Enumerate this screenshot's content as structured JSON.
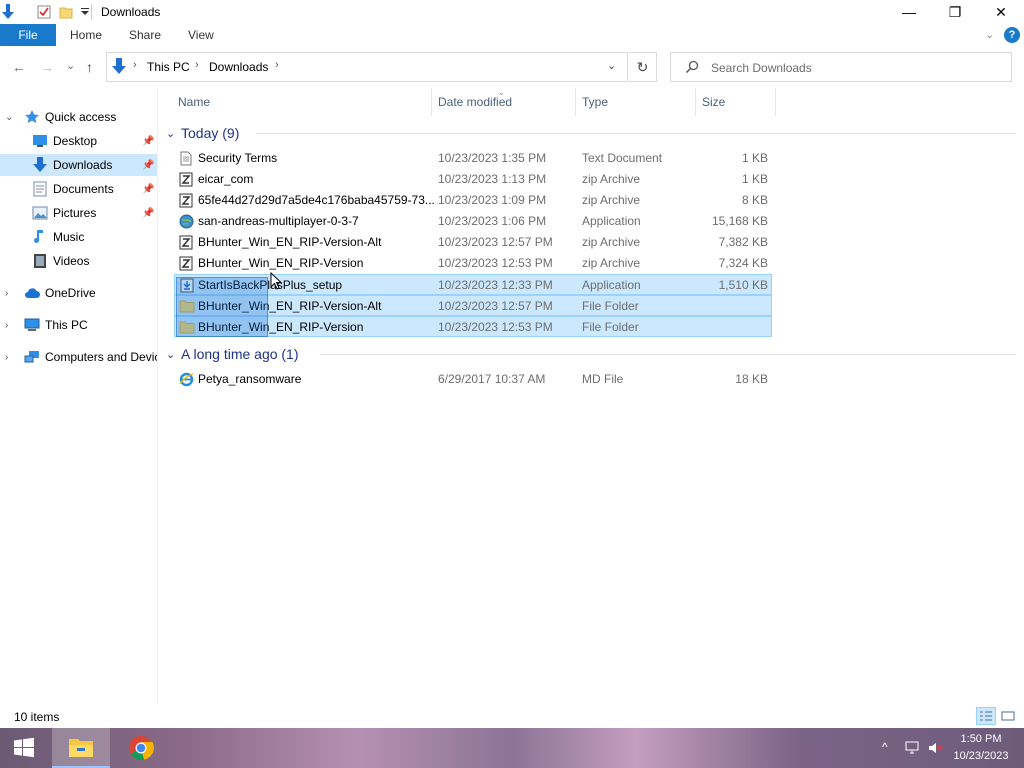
{
  "window": {
    "title": "Downloads",
    "minimize": "—",
    "maximize": "❐",
    "close": "✕"
  },
  "ribbon": {
    "tabs": [
      "File",
      "Home",
      "Share",
      "View"
    ],
    "collapse": "⌄",
    "help": "?"
  },
  "nav": {
    "back": "←",
    "forward": "→",
    "recent": "⌄",
    "up": "↑",
    "breadcrumb": [
      "This PC",
      "Downloads"
    ],
    "refresh": "↻",
    "search_placeholder": "Search Downloads"
  },
  "sidebar": {
    "items": [
      {
        "label": "Quick access",
        "icon": "star-icon"
      },
      {
        "label": "Desktop",
        "icon": "desktop-icon"
      },
      {
        "label": "Downloads",
        "icon": "downloads-icon"
      },
      {
        "label": "Documents",
        "icon": "documents-icon"
      },
      {
        "label": "Pictures",
        "icon": "pictures-icon"
      },
      {
        "label": "Music",
        "icon": "music-icon"
      },
      {
        "label": "Videos",
        "icon": "videos-icon"
      },
      {
        "label": "OneDrive",
        "icon": "cloud-icon"
      },
      {
        "label": "This PC",
        "icon": "computer-icon"
      },
      {
        "label": "Computers and Devices",
        "icon": "network-icon"
      }
    ]
  },
  "columns": {
    "name": "Name",
    "date": "Date modified",
    "type": "Type",
    "size": "Size"
  },
  "groups": [
    {
      "title": "Today (9)",
      "files": [
        {
          "name": "Security Terms",
          "date": "10/23/2023 1:35 PM",
          "type": "Text Document",
          "size": "1 KB",
          "icon": "text-file-icon",
          "selected": false
        },
        {
          "name": "eicar_com",
          "date": "10/23/2023 1:13 PM",
          "type": "zip Archive",
          "size": "1 KB",
          "icon": "zip-file-icon",
          "selected": false
        },
        {
          "name": "65fe44d27d29d7a5de4c176baba45759-73...",
          "date": "10/23/2023 1:09 PM",
          "type": "zip Archive",
          "size": "8 KB",
          "icon": "zip-file-icon",
          "selected": false
        },
        {
          "name": "san-andreas-multiplayer-0-3-7",
          "date": "10/23/2023 1:06 PM",
          "type": "Application",
          "size": "15,168 KB",
          "icon": "app-globe-icon",
          "selected": false
        },
        {
          "name": "BHunter_Win_EN_RIP-Version-Alt",
          "date": "10/23/2023 12:57 PM",
          "type": "zip Archive",
          "size": "7,382 KB",
          "icon": "zip-file-icon",
          "selected": false
        },
        {
          "name": "BHunter_Win_EN_RIP-Version",
          "date": "10/23/2023 12:53 PM",
          "type": "zip Archive",
          "size": "7,324 KB",
          "icon": "zip-file-icon",
          "selected": false
        },
        {
          "name": "StartIsBackPlusPlus_setup",
          "date": "10/23/2023 12:33 PM",
          "type": "Application",
          "size": "1,510 KB",
          "icon": "installer-icon",
          "selected": true
        },
        {
          "name": "BHunter_Win_EN_RIP-Version-Alt",
          "date": "10/23/2023 12:57 PM",
          "type": "File Folder",
          "size": "",
          "icon": "folder-icon",
          "selected": true
        },
        {
          "name": "BHunter_Win_EN_RIP-Version",
          "date": "10/23/2023 12:53 PM",
          "type": "File Folder",
          "size": "",
          "icon": "folder-icon",
          "selected": true
        }
      ]
    },
    {
      "title": "A long time ago (1)",
      "files": [
        {
          "name": "Petya_ransomware",
          "date": "6/29/2017 10:37 AM",
          "type": "MD File",
          "size": "18 KB",
          "icon": "ie-file-icon",
          "selected": false
        }
      ]
    }
  ],
  "status": {
    "count": "10 items"
  },
  "taskbar": {
    "time": "1:50 PM",
    "date": "10/23/2023",
    "tray_chevron": "^"
  },
  "colors": {
    "accent": "#1979ca",
    "selection": "#cce8ff",
    "group_title": "#1e3287"
  }
}
